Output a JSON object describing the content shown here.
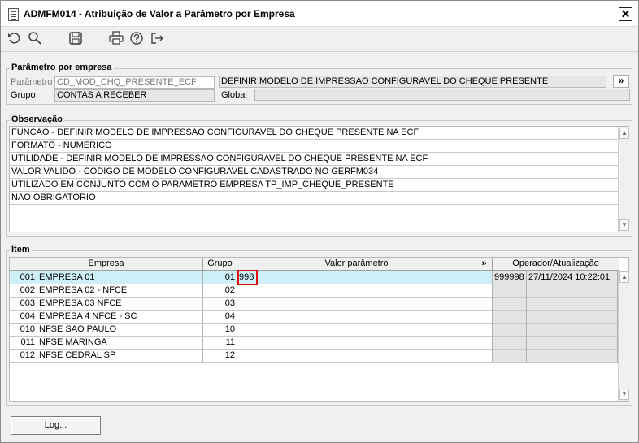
{
  "window": {
    "title": "ADMFM014 - Atribuição de Valor a Parâmetro por Empresa",
    "close_label": "✕"
  },
  "toolbar": {
    "icons": [
      "undo-icon",
      "search-icon",
      "save-icon",
      "print-icon",
      "help-icon",
      "exit-icon"
    ]
  },
  "param_section": {
    "legend": "Parâmetro por empresa",
    "parametro_label": "Parâmetro",
    "parametro_value": "CD_MOD_CHQ_PRESENTE_ECF",
    "descricao": "DEFINIR MODELO DE IMPRESSAO CONFIGURAVEL DO CHEQUE PRESENTE",
    "expand_label": "»",
    "grupo_label": "Grupo",
    "grupo_value": "CONTAS A RECEBER",
    "global_label": "Global",
    "global_value": ""
  },
  "obs_section": {
    "legend": "Observação",
    "lines": [
      "FUNCAO -  DEFINIR MODELO DE IMPRESSAO CONFIGURAVEL DO CHEQUE PRESENTE NA ECF",
      "FORMATO - NUMERICO",
      "UTILIDADE -  DEFINIR MODELO DE IMPRESSAO CONFIGURAVEL DO CHEQUE PRESENTE NA ECF",
      "VALOR VALIDO - CODIGO DE MODELO CONFIGURAVEL CADASTRADO NO GERFM034",
      "UTILIZADO EM CONJUNTO COM O PARAMETRO EMPRESA TP_IMP_CHEQUE_PRESENTE",
      "NAO OBRIGATORIO"
    ]
  },
  "item_section": {
    "legend": "Item",
    "headers": {
      "empresa": "Empresa",
      "grupo": "Grupo",
      "valor": "Valor parâmetro",
      "expand": "»",
      "operador": "Operador/Atualização"
    },
    "rows": [
      {
        "code": "001",
        "empresa": "EMPRESA 01",
        "grupo": "01",
        "valor": "998",
        "operador": "999998",
        "data": "27/11/2024 10:22:01"
      },
      {
        "code": "002",
        "empresa": "EMPRESA 02 - NFCE",
        "grupo": "02",
        "valor": "",
        "operador": "",
        "data": ""
      },
      {
        "code": "003",
        "empresa": "EMPRESA 03 NFCE",
        "grupo": "03",
        "valor": "",
        "operador": "",
        "data": ""
      },
      {
        "code": "004",
        "empresa": "EMPRESA 4 NFCE - SC",
        "grupo": "04",
        "valor": "",
        "operador": "",
        "data": ""
      },
      {
        "code": "010",
        "empresa": "NFSE SAO PAULO",
        "grupo": "10",
        "valor": "",
        "operador": "",
        "data": ""
      },
      {
        "code": "011",
        "empresa": "NFSE MARINGA",
        "grupo": "11",
        "valor": "",
        "operador": "",
        "data": ""
      },
      {
        "code": "012",
        "empresa": "NFSE CEDRAL SP",
        "grupo": "12",
        "valor": "",
        "operador": "",
        "data": ""
      }
    ]
  },
  "footer": {
    "log_label": "Log..."
  },
  "colors": {
    "selected_row": "#cdeff7",
    "highlight_border": "#e01010"
  }
}
